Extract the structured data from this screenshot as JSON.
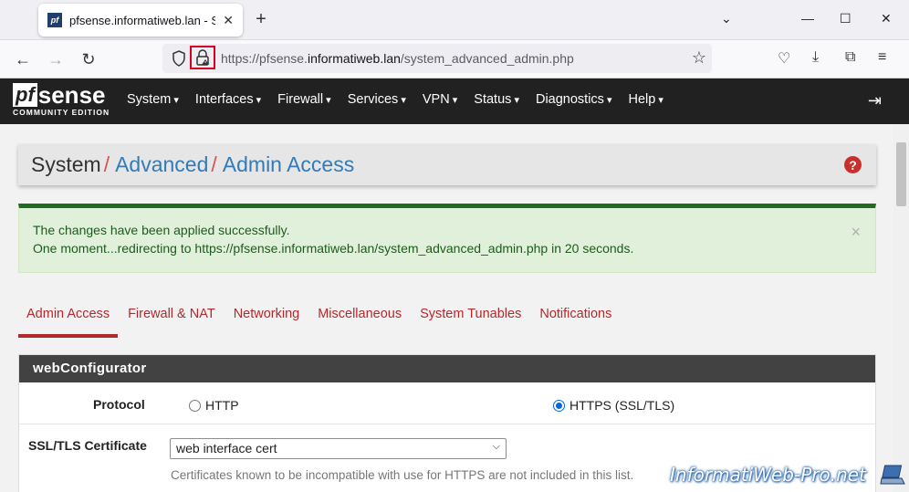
{
  "browser": {
    "tab_title": "pfsense.informatiweb.lan - Syst",
    "favicon_text": "pf",
    "url_prefix": "https://pfsense.",
    "url_domain": "informatiweb.lan",
    "url_path": "/system_advanced_admin.php"
  },
  "pfsense": {
    "logo_mark": "pf",
    "logo_word": "sense",
    "edition": "COMMUNITY EDITION",
    "menu": [
      "System",
      "Interfaces",
      "Firewall",
      "Services",
      "VPN",
      "Status",
      "Diagnostics",
      "Help"
    ]
  },
  "breadcrumb": {
    "root": "System",
    "sep1": "/",
    "link1": "Advanced",
    "sep2": "/",
    "link2": "Admin Access",
    "help": "?"
  },
  "alert": {
    "line1": "The changes have been applied successfully.",
    "line2": "One moment...redirecting to https://pfsense.informatiweb.lan/system_advanced_admin.php in 20 seconds.",
    "close": "×"
  },
  "tabs": [
    "Admin Access",
    "Firewall & NAT",
    "Networking",
    "Miscellaneous",
    "System Tunables",
    "Notifications"
  ],
  "webconfigurator": {
    "title": "webConfigurator",
    "protocol_label": "Protocol",
    "protocol_options": [
      "HTTP",
      "HTTPS (SSL/TLS)"
    ],
    "protocol_selected": "HTTPS (SSL/TLS)",
    "cert_label": "SSL/TLS Certificate",
    "cert_value": "web interface cert",
    "cert_hint": "Certificates known to be incompatible with use for HTTPS are not included in this list."
  },
  "watermark": "InformatiWeb-Pro.net",
  "colors": {
    "pf_nav": "#212121",
    "link": "#337ab7",
    "tab_accent": "#b5282c",
    "alert_bg": "#e0f0da",
    "alert_border": "#1e6b21",
    "section_head": "#424242"
  }
}
